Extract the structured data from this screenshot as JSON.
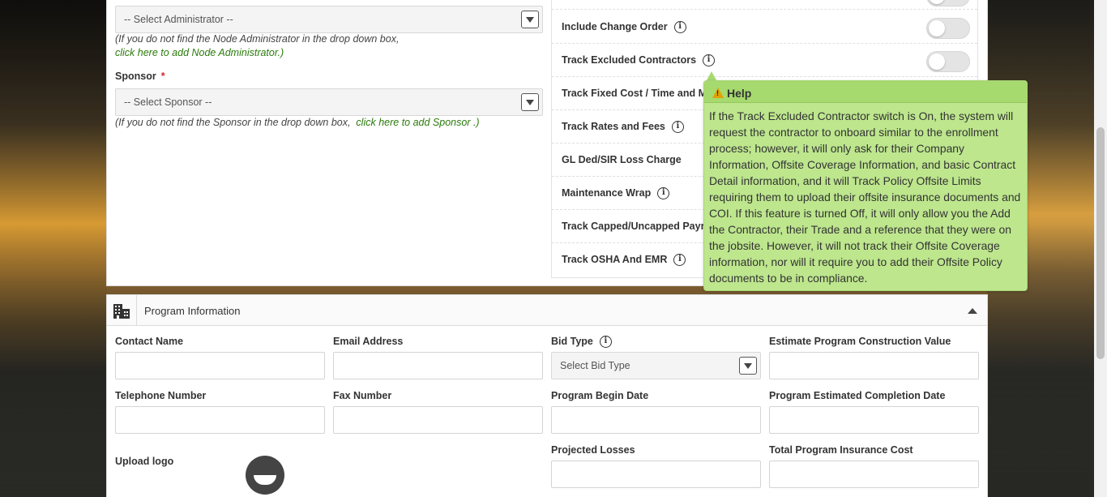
{
  "administrator": {
    "select_placeholder": "-- Select Administrator --",
    "hint_text": "(If you do not find the Node Administrator in the drop down box,",
    "hint_link": "click here to add Node Administrator.)"
  },
  "sponsor": {
    "label": "Sponsor",
    "required_mark": "*",
    "select_placeholder": "-- Select Sponsor --",
    "hint_text": "(If you do not find the Sponsor in the drop down box,",
    "hint_link": "click here to add Sponsor .)"
  },
  "toggles": [
    {
      "label": "Include Change Order",
      "has_info": true,
      "on": false
    },
    {
      "label": "Track Excluded Contractors",
      "has_info": true,
      "on": false
    },
    {
      "label": "Track Fixed Cost / Time and M",
      "has_info": false
    },
    {
      "label": "Track Rates and Fees",
      "has_info": true
    },
    {
      "label": "GL Ded/SIR Loss Charge",
      "has_info": false
    },
    {
      "label": "Maintenance Wrap",
      "has_info": true
    },
    {
      "label": "Track Capped/Uncapped Payro",
      "has_info": false
    },
    {
      "label": "Track OSHA And EMR",
      "has_info": true
    }
  ],
  "tooltip": {
    "title": "Help",
    "body": "If the Track Excluded Contractor switch is On, the system will request the contractor to onboard similar to the enrollment process; however, it will only ask for their Company Information, Offsite Coverage Information, and basic Contract Detail information, and it will Track Policy Offsite Limits requiring them to upload their offsite insurance documents and COI. If this feature is turned Off, it will only allow you the Add the Contractor, their Trade and a reference that they were on the jobsite. However, it will not track their Offsite Coverage information, nor will it require you to add their Offsite Policy documents to be in compliance.",
    "colors": {
      "background": "#bde68d",
      "header": "#a6d96e"
    }
  },
  "program": {
    "section_title": "Program Information",
    "fields": {
      "contact_name": "Contact Name",
      "email_address": "Email Address",
      "bid_type": "Bid Type",
      "bid_type_placeholder": "Select Bid Type",
      "estimate_value": "Estimate Program Construction Value",
      "telephone": "Telephone Number",
      "fax": "Fax Number",
      "begin_date": "Program Begin Date",
      "completion_date": "Program Estimated Completion Date",
      "upload_logo": "Upload logo",
      "projected_losses": "Projected Losses",
      "insurance_cost": "Total Program Insurance Cost"
    }
  },
  "icons": {
    "info": "info-icon",
    "warning": "warning-icon",
    "building": "building-icon",
    "chevron": "chevron-up-icon"
  }
}
